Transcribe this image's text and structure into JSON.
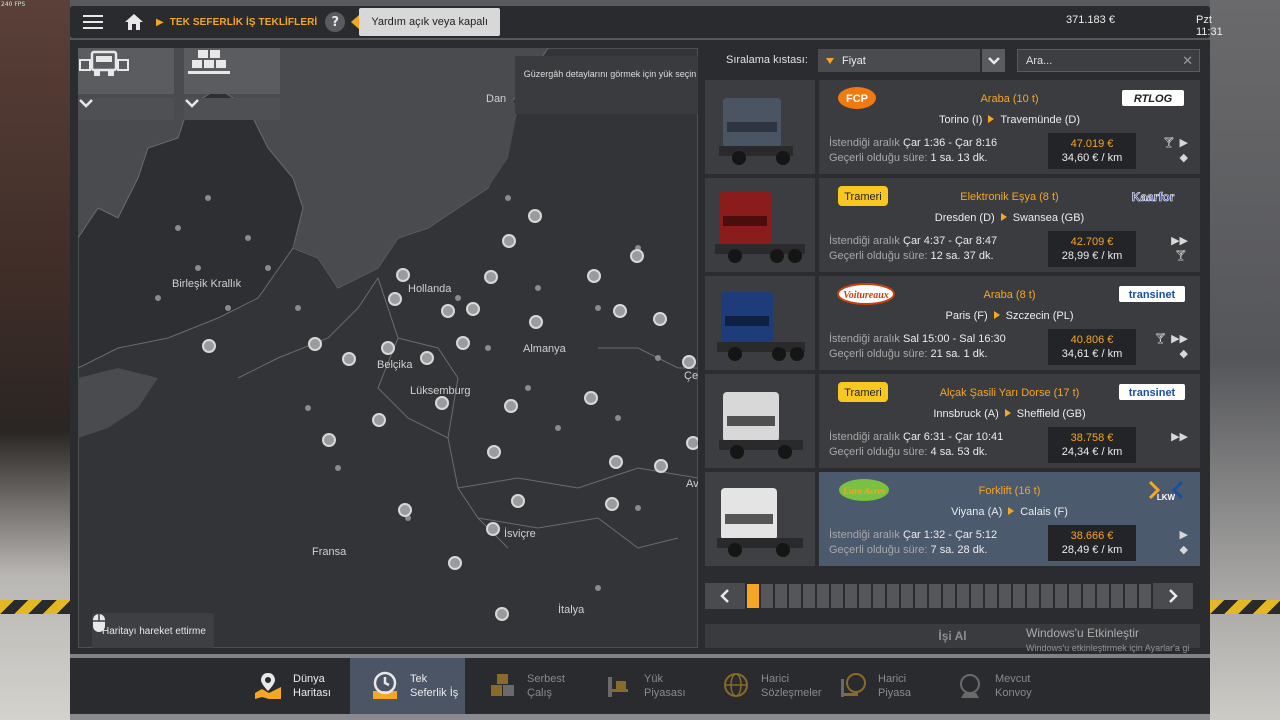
{
  "fps": "240 FPS",
  "topbar": {
    "breadcrumb": "TEK SEFERLİK İŞ TEKLİFLERİ",
    "help": "?",
    "tooltip": "Yardım açık veya kapalı",
    "money": "371.183 €",
    "clock": "Pzt 11:31"
  },
  "map": {
    "info": "Güzergâh detaylarını görmek için yük seçin",
    "hint": "Haritayı hareket ettirme",
    "labels": {
      "uk": "Birleşik Krallık",
      "nl": "Hollanda",
      "be": "Belçika",
      "lu": "Lüksemburg",
      "de": "Almanya",
      "fr": "Fransa",
      "ch": "İsviçre",
      "it": "İtalya",
      "dan": "Dan",
      "ce": "Çe",
      "av": "Av"
    }
  },
  "sort": {
    "label": "Sıralama kıstası:",
    "value": "Fiyat",
    "search_placeholder": "Ara..."
  },
  "labels": {
    "window": "İstendiği aralık",
    "valid": "Geçerli olduğu süre:"
  },
  "jobs": [
    {
      "company": "FCP",
      "client": "RTLOG",
      "cargo": "Araba (10 t)",
      "from": "Torino (I)",
      "to": "Travemünde (D)",
      "window": "Çar 1:36 - Çar 8:16",
      "valid": "1 sa. 13 dk.",
      "price": "47.019 €",
      "perkm": "34,60 € / km"
    },
    {
      "company": "Trameri",
      "client": "Kaarfor",
      "cargo": "Elektronik Eşya (8 t)",
      "from": "Dresden (D)",
      "to": "Swansea (GB)",
      "window": "Çar 4:37 - Çar 8:47",
      "valid": "12 sa. 37 dk.",
      "price": "42.709 €",
      "perkm": "28,99 € / km"
    },
    {
      "company": "Voitureaux",
      "client": "transinet",
      "cargo": "Araba (8 t)",
      "from": "Paris (F)",
      "to": "Szczecin (PL)",
      "window": "Sal 15:00 - Sal 16:30",
      "valid": "21 sa. 1 dk.",
      "price": "40.806 €",
      "perkm": "34,61 € / km"
    },
    {
      "company": "Trameri",
      "client": "transinet",
      "cargo": "Alçak Şasili Yarı Dorse (17 t)",
      "from": "Innsbruck (A)",
      "to": "Sheffield (GB)",
      "window": "Çar 6:31 - Çar 10:41",
      "valid": "4 sa. 53 dk.",
      "price": "38.758 €",
      "perkm": "24,34 € / km"
    },
    {
      "company": "Euro Acres",
      "client": "LKW",
      "cargo": "Forklift (16 t)",
      "from": "Viyana (A)",
      "to": "Calais (F)",
      "window": "Çar 1:32 - Çar 5:12",
      "valid": "7 sa. 28 dk.",
      "price": "38.666 €",
      "perkm": "28,49 € / km"
    }
  ],
  "take_job": "İşi Al",
  "watermark": {
    "title": "Windows'u Etkinleştir",
    "sub": "Windows'u etkinleştirmek için Ayarlar'a gi"
  },
  "nav": {
    "world": "Dünya Haritası",
    "single": "Tek Seferlik İş",
    "free": "Serbest Çalış",
    "cargo_market": "Yük Piyasası",
    "ext_contracts": "Harici Sözleşmeler",
    "ext_market": "Harici Piyasa",
    "convoy": "Mevcut Konvoy"
  },
  "colors": {
    "accent": "#f5a623",
    "active_tab": "#4b5566",
    "active_row": "#4b5a6c"
  }
}
